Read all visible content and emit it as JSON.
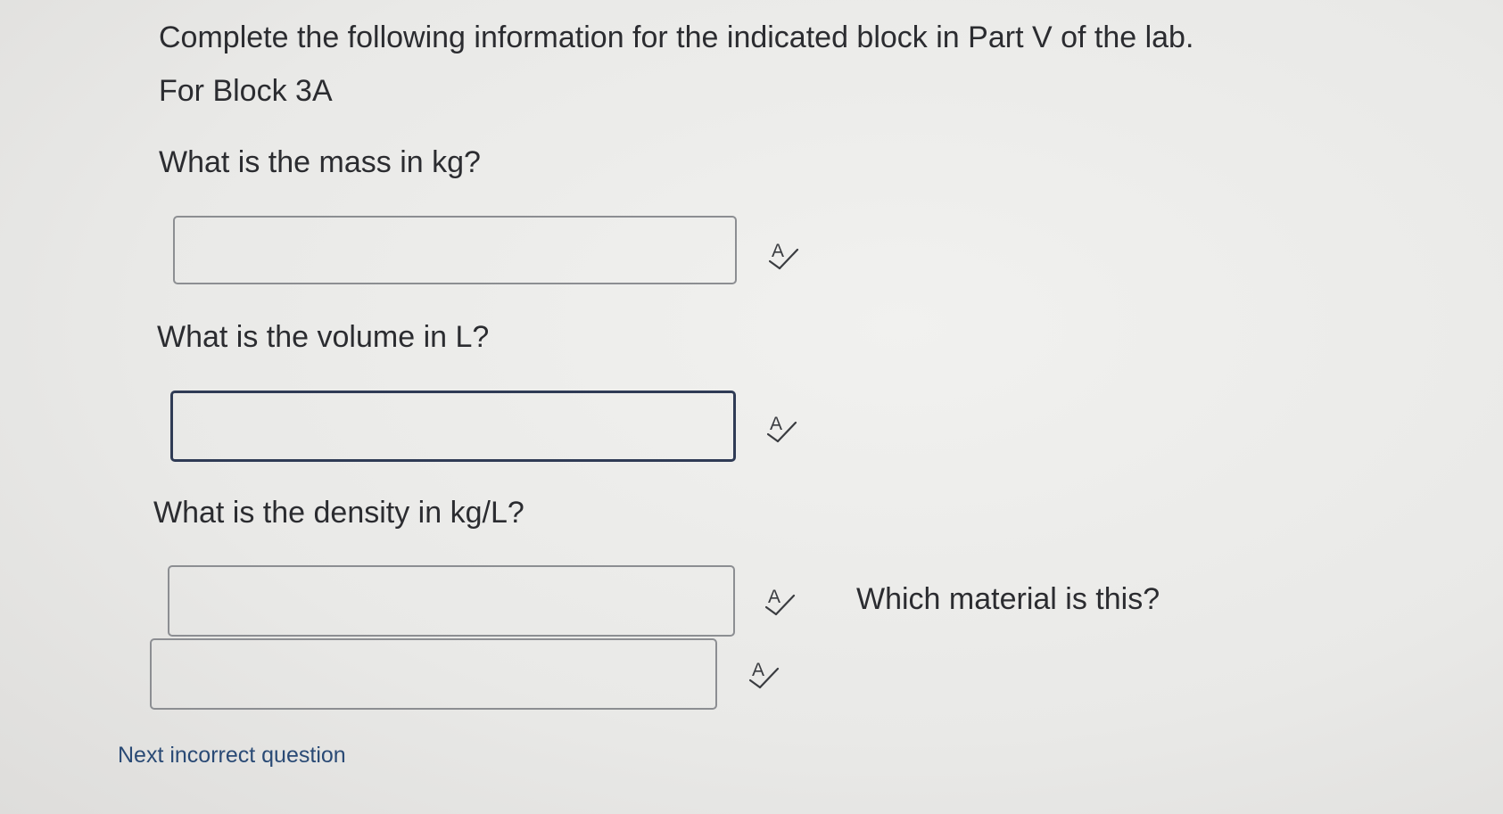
{
  "instructions": "Complete the following information for the indicated block in Part V of the lab.",
  "block_label": "For Block 3A",
  "questions": {
    "mass": {
      "prompt": "What is the mass in kg?",
      "value": ""
    },
    "volume": {
      "prompt": "What is the volume in L?",
      "value": ""
    },
    "density": {
      "prompt": "What is the density in kg/L?",
      "value": ""
    },
    "material": {
      "prompt": "Which material is this?",
      "value": ""
    }
  },
  "spellcheck_icon_label": "A",
  "icons": {
    "spellcheck": "spellcheck-icon"
  },
  "next_link": "Next incorrect question",
  "colors": {
    "text": "#2b2c30",
    "link": "#2a4a75",
    "field_border": "#8c8e92",
    "field_focus_border": "#2f3b55",
    "icon": "#3a3c40"
  }
}
